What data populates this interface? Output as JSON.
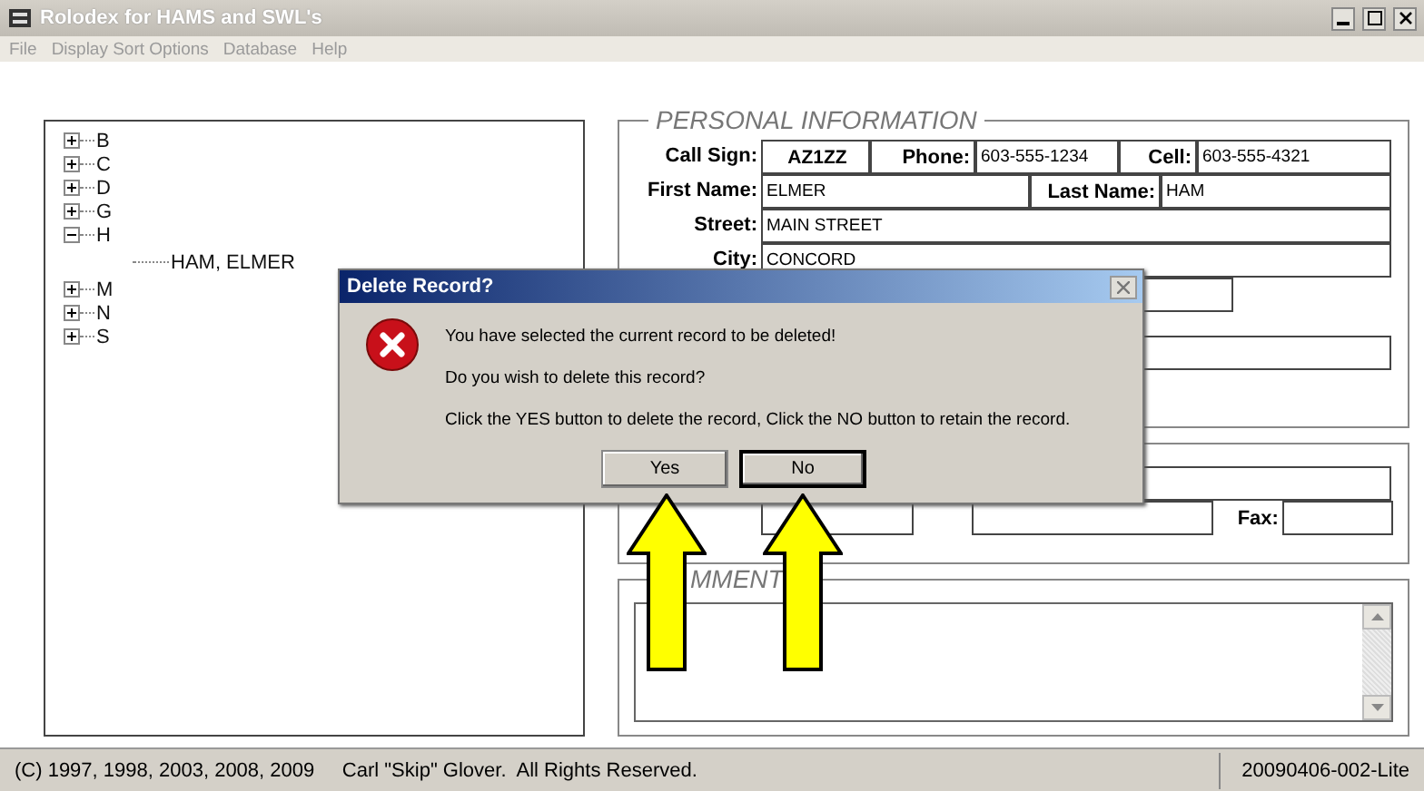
{
  "window": {
    "title": "Rolodex for HAMS and SWL's"
  },
  "menu": [
    "File",
    "Display Sort Options",
    "Database",
    "Help"
  ],
  "tree": [
    {
      "label": "B",
      "expanded": false
    },
    {
      "label": "C",
      "expanded": false
    },
    {
      "label": "D",
      "expanded": false
    },
    {
      "label": "G",
      "expanded": false
    },
    {
      "label": "H",
      "expanded": true,
      "children": [
        {
          "label": "HAM, ELMER"
        }
      ]
    },
    {
      "label": "M",
      "expanded": false
    },
    {
      "label": "N",
      "expanded": false
    },
    {
      "label": "S",
      "expanded": false
    }
  ],
  "personal": {
    "title": "PERSONAL INFORMATION",
    "call_sign": {
      "label": "Call Sign:",
      "value": "AZ1ZZ"
    },
    "phone": {
      "label": "Phone:",
      "value": "603-555-1234"
    },
    "cell": {
      "label": "Cell:",
      "value": "603-555-4321"
    },
    "first_name": {
      "label": "First Name:",
      "value": "ELMER"
    },
    "last_name": {
      "label": "Last Name:",
      "value": "HAM"
    },
    "street": {
      "label": "Street:",
      "value": "MAIN STREET"
    },
    "city": {
      "label": "City:",
      "value": "CONCORD"
    }
  },
  "contact": {
    "fax_label": "Fax:"
  },
  "comments": {
    "title": "MMENT"
  },
  "dialog": {
    "title": "Delete Record?",
    "lines": [
      "You have selected the current record to be deleted!",
      "Do you wish to delete this record?",
      "Click the YES button to delete the record, Click the NO button to retain the record."
    ],
    "buttons": [
      {
        "label": "Yes",
        "selected": false
      },
      {
        "label": "No",
        "selected": true
      }
    ]
  },
  "status_bar": {
    "copyright": "(C) 1997, 1998, 2003, 2008, 2009     Carl \"Skip\" Glover.  All Rights Reserved.",
    "version": "20090406-002-Lite"
  }
}
